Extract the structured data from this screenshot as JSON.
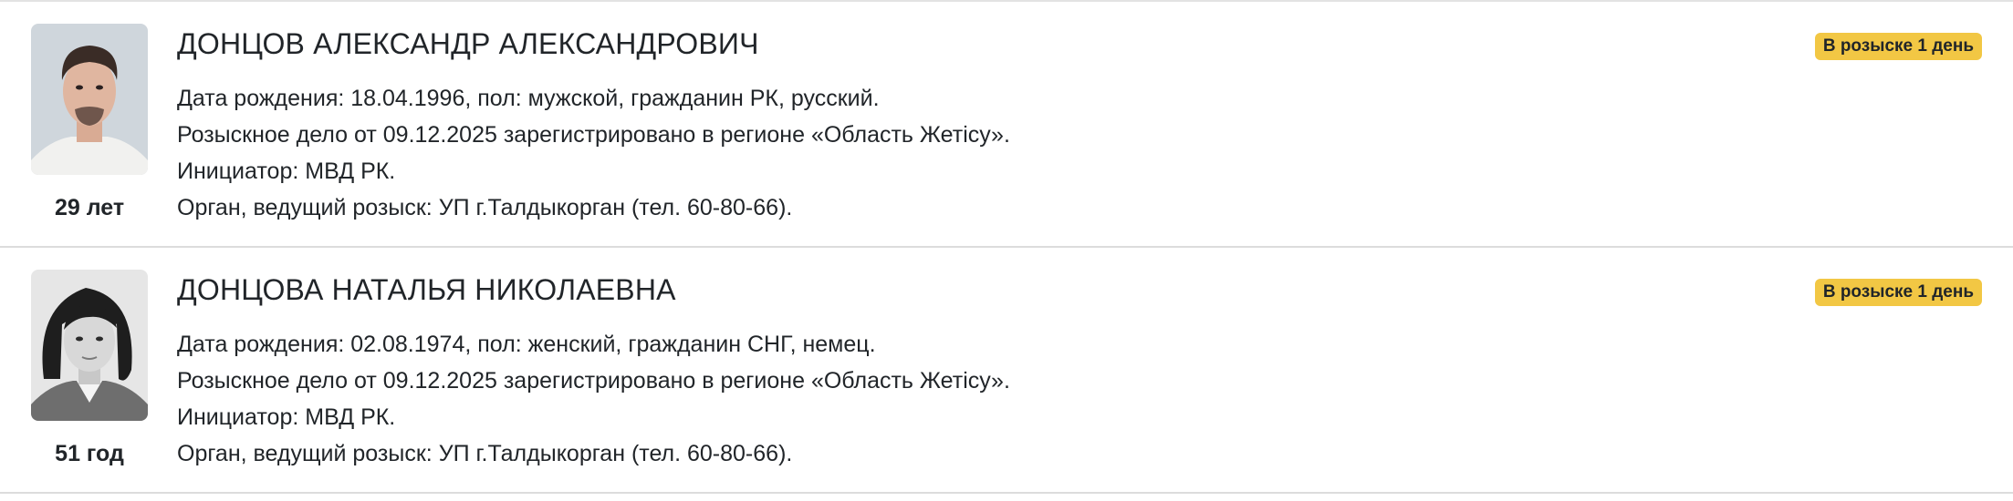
{
  "records": [
    {
      "name": "ДОНЦОВ АЛЕКСАНДР АЛЕКСАНДРОВИЧ",
      "age": "29 лет",
      "badge": "В розыске 1 день",
      "birth": "Дата рождения: 18.04.1996, пол: мужской, гражданин РК, русский.",
      "case": "Розыскное дело от 09.12.2025 зарегистрировано в регионе «Область Жетісу».",
      "initiator": "Инициатор: МВД РК.",
      "agency": "Орган, ведущий розыск: УП г.Талдыкорган (тел. 60-80-66).",
      "photo_icon": "person-photo"
    },
    {
      "name": "ДОНЦОВА НАТАЛЬЯ НИКОЛАЕВНА",
      "age": "51 год",
      "badge": "В розыске 1 день",
      "birth": "Дата рождения: 02.08.1974, пол: женский, гражданин СНГ, немец.",
      "case": "Розыскное дело от 09.12.2025 зарегистрировано в регионе «Область Жетісу».",
      "initiator": "Инициатор: МВД РК.",
      "agency": "Орган, ведущий розыск: УП г.Талдыкорган (тел. 60-80-66).",
      "photo_icon": "person-photo-bw"
    }
  ],
  "colors": {
    "badge": "#f2c744",
    "text": "#212529",
    "divider": "#dcdcdc"
  }
}
